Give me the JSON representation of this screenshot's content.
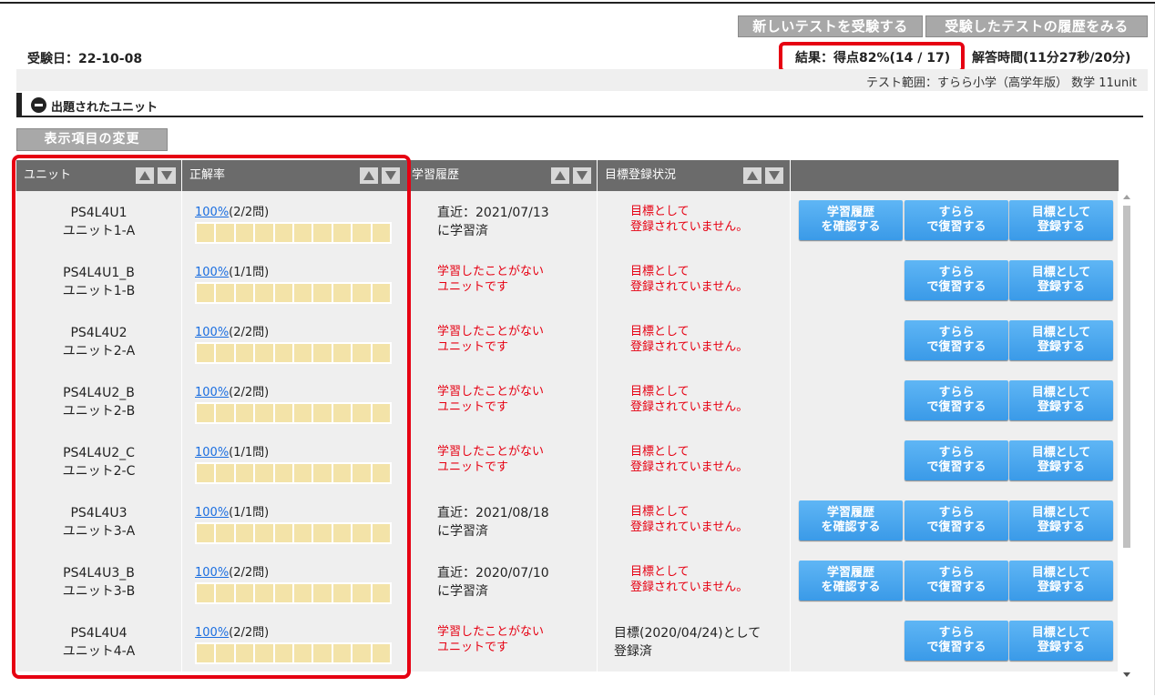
{
  "header": {
    "new_test_button": "新しいテストを受験する",
    "history_button": "受験したテストの履歴をみる",
    "exam_date": "受験日：22-10-08",
    "result": "結果：得点82%(14 / 17)",
    "answer_time": "解答時間(11分27秒/20分)",
    "test_range": "テスト範囲：すらら小学（高学年版） 数学 11unit"
  },
  "section": {
    "title": "出題されたユニット",
    "change_display_button": "表示項目の変更"
  },
  "table": {
    "columns": [
      "ユニット",
      "正解率",
      "学習履歴",
      "目標登録状況",
      ""
    ],
    "action_labels": {
      "history_line1": "学習履歴",
      "history_line2": "を確認する",
      "review_line1": "すらら",
      "review_line2": "で復習する",
      "goal_line1": "目標として",
      "goal_line2": "登録する"
    },
    "rows": [
      {
        "code": "PS4L4U1",
        "name": "ユニット1-A",
        "pct": "100%",
        "count": "(2/2問)",
        "hist1": "直近：2021/07/13",
        "hist2": "に学習済",
        "hist_none": false,
        "goal1": "目標として",
        "goal2": "登録されていません。",
        "goal_done": false,
        "has_history_btn": true
      },
      {
        "code": "PS4L4U1_B",
        "name": "ユニット1-B",
        "pct": "100%",
        "count": "(1/1問)",
        "hist1": "学習したことがない",
        "hist2": "ユニットです",
        "hist_none": true,
        "goal1": "目標として",
        "goal2": "登録されていません。",
        "goal_done": false,
        "has_history_btn": false
      },
      {
        "code": "PS4L4U2",
        "name": "ユニット2-A",
        "pct": "100%",
        "count": "(2/2問)",
        "hist1": "学習したことがない",
        "hist2": "ユニットです",
        "hist_none": true,
        "goal1": "目標として",
        "goal2": "登録されていません。",
        "goal_done": false,
        "has_history_btn": false
      },
      {
        "code": "PS4L4U2_B",
        "name": "ユニット2-B",
        "pct": "100%",
        "count": "(2/2問)",
        "hist1": "学習したことがない",
        "hist2": "ユニットです",
        "hist_none": true,
        "goal1": "目標として",
        "goal2": "登録されていません。",
        "goal_done": false,
        "has_history_btn": false
      },
      {
        "code": "PS4L4U2_C",
        "name": "ユニット2-C",
        "pct": "100%",
        "count": "(1/1問)",
        "hist1": "学習したことがない",
        "hist2": "ユニットです",
        "hist_none": true,
        "goal1": "目標として",
        "goal2": "登録されていません。",
        "goal_done": false,
        "has_history_btn": false
      },
      {
        "code": "PS4L4U3",
        "name": "ユニット3-A",
        "pct": "100%",
        "count": "(1/1問)",
        "hist1": "直近：2021/08/18",
        "hist2": "に学習済",
        "hist_none": false,
        "goal1": "目標として",
        "goal2": "登録されていません。",
        "goal_done": false,
        "has_history_btn": true
      },
      {
        "code": "PS4L4U3_B",
        "name": "ユニット3-B",
        "pct": "100%",
        "count": "(2/2問)",
        "hist1": "直近：2020/07/10",
        "hist2": "に学習済",
        "hist_none": false,
        "goal1": "目標として",
        "goal2": "登録されていません。",
        "goal_done": false,
        "has_history_btn": true
      },
      {
        "code": "PS4L4U4",
        "name": "ユニット4-A",
        "pct": "100%",
        "count": "(2/2問)",
        "hist1": "学習したことがない",
        "hist2": "ユニットです",
        "hist_none": true,
        "goal1": "目標(2020/04/24)として",
        "goal2": "登録済",
        "goal_done": true,
        "has_history_btn": false
      }
    ]
  },
  "colors": {
    "highlight": "#e60012",
    "button_blue": "#3a9ae8",
    "header_gray": "#6b6b6b",
    "bar_fill": "#f3e3a8"
  }
}
